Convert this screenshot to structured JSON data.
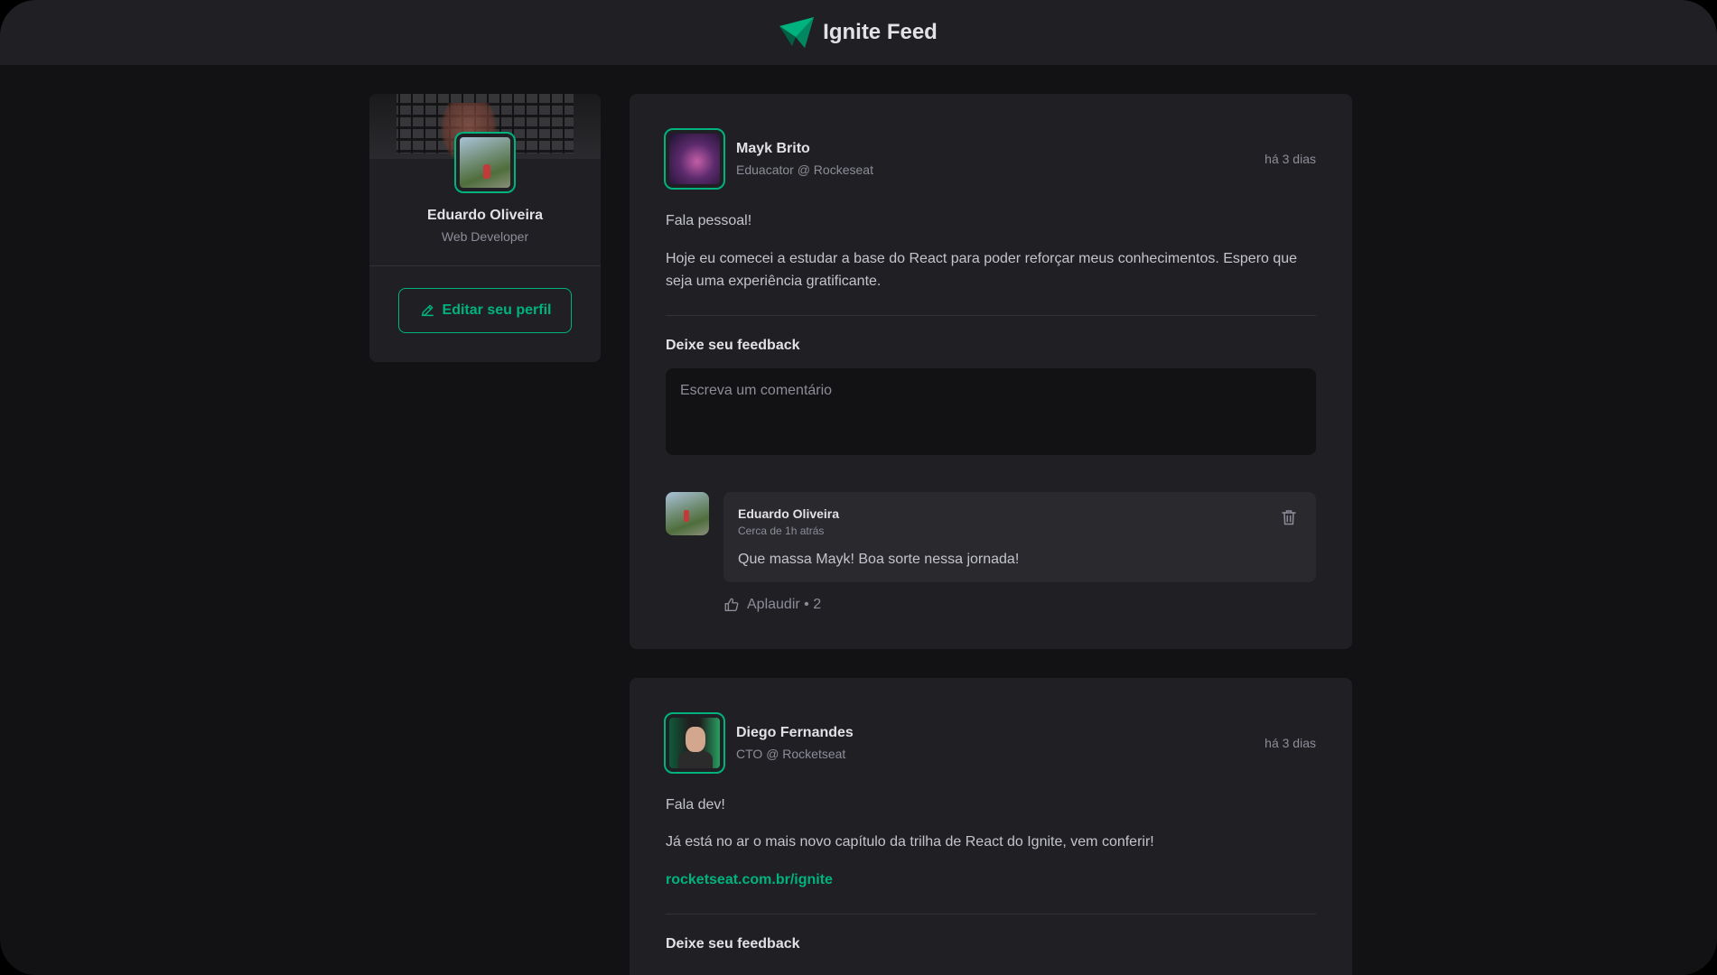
{
  "header": {
    "title": "Ignite Feed",
    "logo_icon": "paper-plane-icon"
  },
  "profile": {
    "name": "Eduardo Oliveira",
    "role": "Web Developer",
    "edit_label": "Editar seu perfil"
  },
  "colors": {
    "accent": "#00b37e",
    "background": "#121214",
    "card": "#202024",
    "comment_bg": "#29292e"
  },
  "posts": [
    {
      "author": {
        "name": "Mayk Brito",
        "role": "Eduacator @ Rockeseat"
      },
      "published": "há 3 dias",
      "paragraphs": [
        "Fala pessoal!",
        "Hoje eu comecei a estudar a base do React para poder reforçar meus conhecimentos. Espero que seja uma experiência gratificante."
      ],
      "feedback_title": "Deixe seu feedback",
      "comment_placeholder": "Escreva um comentário",
      "comments": [
        {
          "author": "Eduardo Oliveira",
          "time": "Cerca de 1h atrás",
          "text": "Que massa Mayk! Boa sorte nessa jornada!",
          "applaud": "Aplaudir • 2"
        }
      ]
    },
    {
      "author": {
        "name": "Diego Fernandes",
        "role": "CTO @ Rocketseat"
      },
      "published": "há 3 dias",
      "paragraphs": [
        "Fala dev!",
        "Já está no ar o mais novo capítulo da trilha de React do Ignite, vem conferir!"
      ],
      "link": "rocketseat.com.br/ignite",
      "feedback_title": "Deixe seu feedback"
    }
  ]
}
